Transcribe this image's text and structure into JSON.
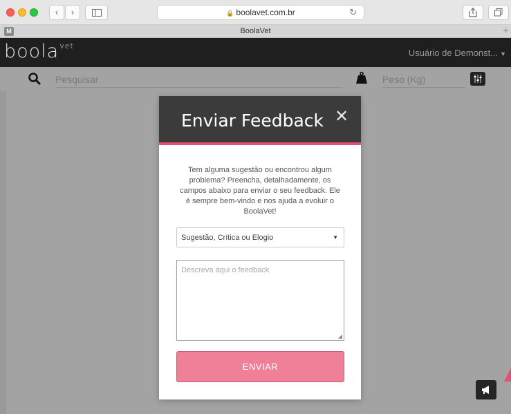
{
  "browser": {
    "address": "boolavet.com.br",
    "tab_title": "BoolaVet",
    "tab_favicon": "M"
  },
  "app": {
    "logo_text": "boola",
    "logo_sup": "vet",
    "user_menu_label": "Usuário de Demonst..."
  },
  "search": {
    "placeholder": "Pesquisar",
    "weight_placeholder": "Peso (Kg)"
  },
  "modal": {
    "title": "Enviar Feedback",
    "close_icon": "close-icon",
    "description": "Tem alguma sugestão ou encontrou algum problema? Preencha, detalhadamente, os campos abaixo para enviar o seu feedback. Ele é sempre bem-vindo e nos ajuda a evoluir o BoolaVet!",
    "type_select_value": "Sugestão, Crítica ou Elogio",
    "feedback_placeholder": "Descreva aqui o feedback",
    "send_label": "ENVIAR"
  },
  "colors": {
    "accent": "#e94d71",
    "button": "#ef8098",
    "header": "#1f1f1f",
    "modal_header": "#3b3b3b",
    "backdrop": "#a3a3a3"
  }
}
